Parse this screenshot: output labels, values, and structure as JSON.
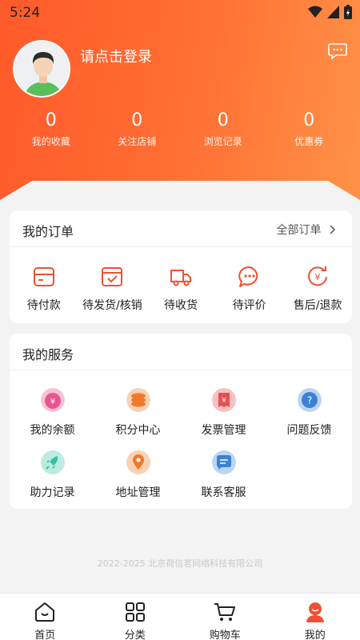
{
  "status": {
    "time": "5:24"
  },
  "profile": {
    "login_prompt": "请点击登录"
  },
  "stats": [
    {
      "value": "0",
      "label": "我的收藏"
    },
    {
      "value": "0",
      "label": "关注店铺"
    },
    {
      "value": "0",
      "label": "浏览记录"
    },
    {
      "value": "0",
      "label": "优惠券"
    }
  ],
  "orders": {
    "title": "我的订单",
    "all_label": "全部订单",
    "items": [
      {
        "label": "待付款",
        "icon": "wallet-icon"
      },
      {
        "label": "待发货/核销",
        "icon": "box-check-icon"
      },
      {
        "label": "待收货",
        "icon": "truck-icon"
      },
      {
        "label": "待评价",
        "icon": "comment-icon"
      },
      {
        "label": "售后/退款",
        "icon": "refund-icon"
      }
    ]
  },
  "services": {
    "title": "我的服务",
    "items": [
      {
        "label": "我的余额",
        "icon": "balance-icon",
        "color": "#e9568f"
      },
      {
        "label": "积分中心",
        "icon": "points-icon",
        "color": "#f07a2a"
      },
      {
        "label": "发票管理",
        "icon": "invoice-icon",
        "color": "#e94f4f"
      },
      {
        "label": "问题反馈",
        "icon": "feedback-icon",
        "color": "#3b82d6"
      },
      {
        "label": "助力记录",
        "icon": "rocket-icon",
        "color": "#36c1a0"
      },
      {
        "label": "地址管理",
        "icon": "location-icon",
        "color": "#f07a2a"
      },
      {
        "label": "联系客服",
        "icon": "service-icon",
        "color": "#3b82d6"
      }
    ]
  },
  "copyright": "2022-2025 北京荷信茗网络科技有限公司",
  "tabbar": [
    {
      "label": "首页",
      "icon": "home-icon"
    },
    {
      "label": "分类",
      "icon": "category-icon"
    },
    {
      "label": "购物车",
      "icon": "cart-icon"
    },
    {
      "label": "我的",
      "icon": "mine-icon"
    }
  ],
  "colors": {
    "accent": "#ff6a30",
    "order_icon": "#f0512e"
  }
}
